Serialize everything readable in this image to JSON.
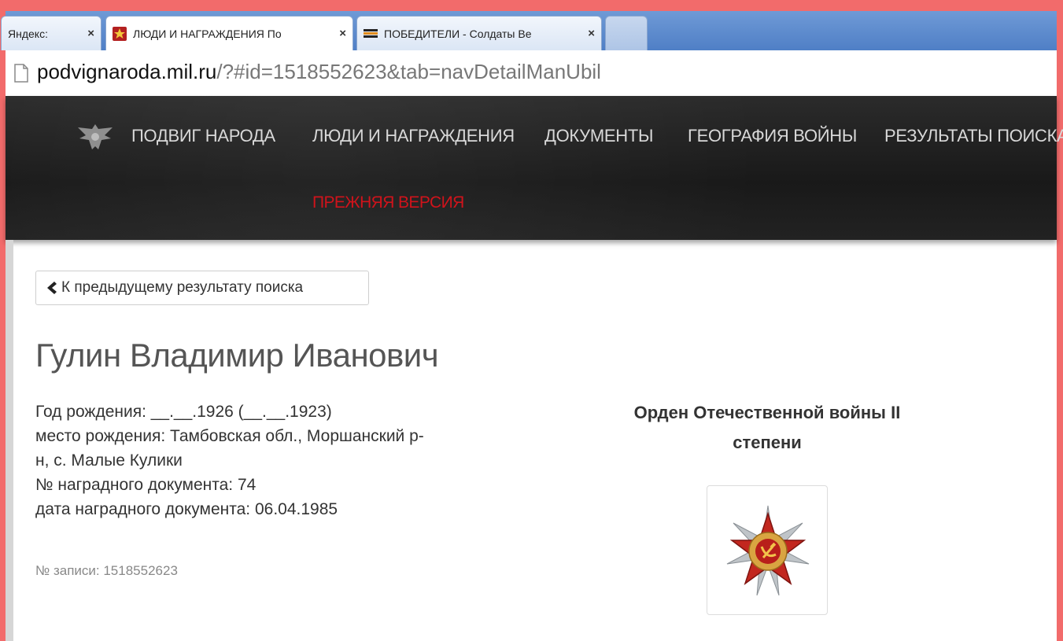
{
  "browser": {
    "tabs": [
      {
        "title": "Яндекс: ",
        "close": "×",
        "active": false
      },
      {
        "title": "ЛЮДИ И НАГРАЖДЕНИЯ По",
        "close": "×",
        "active": true
      },
      {
        "title": "ПОБЕДИТЕЛИ - Солдаты Ве",
        "close": "×",
        "active": false
      }
    ],
    "url": {
      "host": "podvignaroda.mil.ru",
      "path": "/?#id=1518552623&tab=navDetailManUbil"
    }
  },
  "site_nav": {
    "brand": "ПОДВИГ НАРОДА",
    "items": [
      "ЛЮДИ И НАГРАЖДЕНИЯ",
      "ДОКУМЕНТЫ",
      "ГЕОГРАФИЯ ВОЙНЫ",
      "РЕЗУЛЬТАТЫ ПОИСКА"
    ],
    "old_version": "ПРЕЖНЯЯ ВЕРСИЯ"
  },
  "content": {
    "back_button": "К предыдущему результату поиска",
    "person_name": "Гулин Владимир Иванович",
    "details": [
      "Год рождения: __.__.1926 (__.__.1923)",
      "место рождения: Тамбовская обл., Моршанский р-",
      "н, с. Малые Кулики",
      "№ наградного документа: 74",
      "дата наградного документа: 06.04.1985"
    ],
    "record_number": "№ записи: 1518552623",
    "award": {
      "title_line1": "Орден Отечественной войны II",
      "title_line2": "степени"
    }
  },
  "colors": {
    "frame": "#f26b6b",
    "tabbar": "#4f7fc6",
    "nav_background": "#1c1c1c",
    "nav_text": "#d8d8d8",
    "old_version": "#d0131b"
  },
  "icons": {
    "page": "page-icon",
    "eagle": "eagle-emblem-icon",
    "back": "chevron-left-icon",
    "award": "order-patriotic-war-icon"
  }
}
